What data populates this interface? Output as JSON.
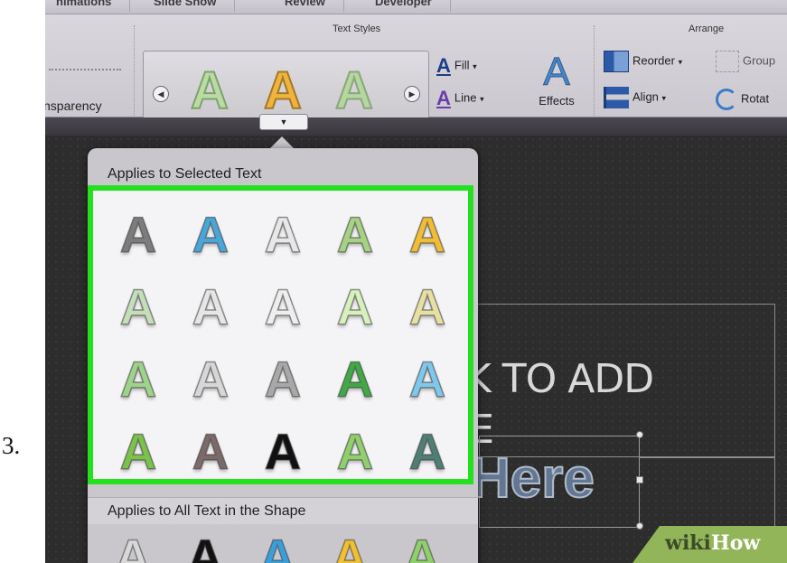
{
  "step_number": "3.",
  "ribbon": {
    "tabs": [
      "nimations",
      "Slide Show",
      "Review",
      "Developer"
    ],
    "groups": {
      "text_styles": "Text Styles",
      "arrange": "Arrange"
    },
    "transparency_label": "nsparency",
    "fill_label": "Fill",
    "line_label": "Line",
    "effects_label": "Effects",
    "reorder_label": "Reorder",
    "align_label": "Align",
    "group_label": "Group",
    "rotate_label": "Rotat"
  },
  "gallery_preview_colors": [
    "#bcd9a6",
    "#f0b43c",
    "#b6d5a0"
  ],
  "popover": {
    "section_selected": "Applies to Selected Text",
    "section_all": "Applies to All Text in the Shape",
    "highlight_color": "#23e11f",
    "styles_glyph": "A",
    "grid_colors": [
      [
        "#7c7c7c",
        "#4aa6d8",
        "#e8e8e8",
        "#a7d183",
        "#f0bd34"
      ],
      [
        "#c5ddb8",
        "#e6e6e6",
        "#eeeeee",
        "#d8f0bc",
        "#e6e0a3"
      ],
      [
        "#9fd38b",
        "#d7d7d7",
        "#a8a8a8",
        "#42a845",
        "#7fc8ea"
      ],
      [
        "#7bc24d",
        "#7c6a6a",
        "#111111",
        "#8fcf6c",
        "#4f7f74"
      ]
    ],
    "bottom_row_colors": [
      "#d8d8d8",
      "#111111",
      "#3a9ed8",
      "#f0c030",
      "#8fcf6c"
    ]
  },
  "slide": {
    "title_text": "CLICK TO ADD\nTITLE",
    "title_visible": "CLCK TO ADD",
    "title_line2": "TITLE",
    "here_text": "Here"
  },
  "watermark": {
    "part1": "wiki",
    "part2": "How"
  }
}
